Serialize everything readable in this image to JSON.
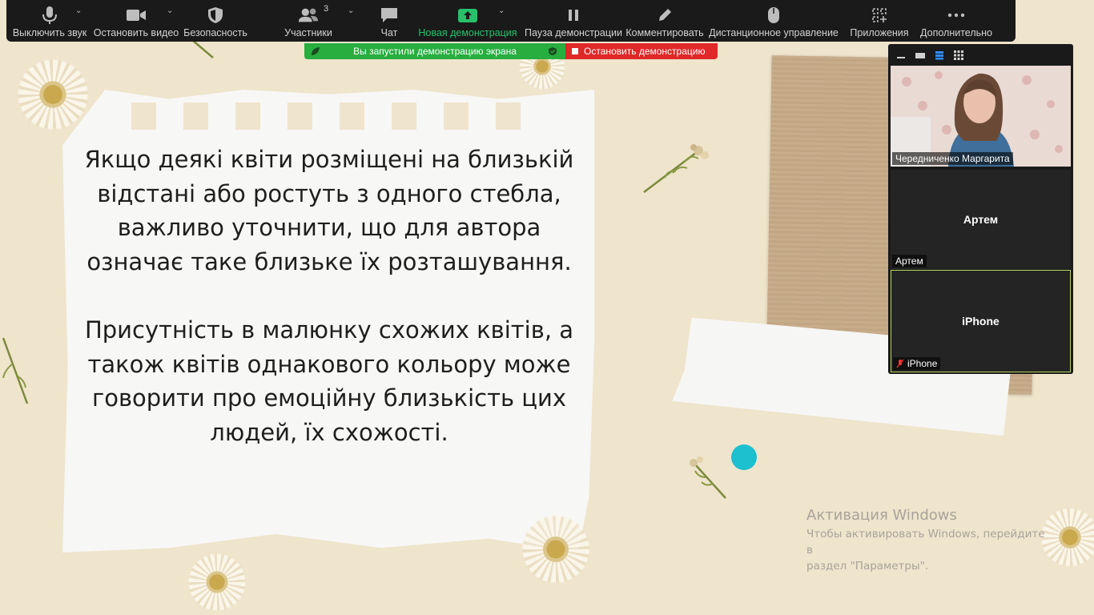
{
  "toolbar": {
    "items": [
      {
        "label": "Выключить звук",
        "icon": "microphone-icon"
      },
      {
        "label": "Остановить видео",
        "icon": "video-camera-icon"
      },
      {
        "label": "Безопасность",
        "icon": "shield-icon"
      },
      {
        "label": "Участники",
        "icon": "participants-icon",
        "badge": "3"
      },
      {
        "label": "Чат",
        "icon": "chat-bubble-icon"
      },
      {
        "label": "Новая демонстрация",
        "icon": "share-screen-icon"
      },
      {
        "label": "Пауза демонстрации",
        "icon": "pause-icon"
      },
      {
        "label": "Комментировать",
        "icon": "pencil-icon"
      },
      {
        "label": "Дистанционное управление",
        "icon": "mouse-icon"
      },
      {
        "label": "Приложения",
        "icon": "apps-icon"
      },
      {
        "label": "Дополнительно",
        "icon": "more-dots-icon"
      }
    ],
    "accent_color": "#25c26a"
  },
  "share_banner": {
    "status_text": "Вы запустили демонстрацию экрана",
    "stop_label": "Остановить демонстрацию",
    "status_color": "#27ae3f",
    "stop_color": "#e02828"
  },
  "slide": {
    "paragraph1": "Якщо деякі квіти розміщені на близькій відстані або ростуть з одного стебла, важливо уточнити, що для автора означає таке близьке їх розташування.",
    "paragraph2": "Присутність в малюнку схожих квітів, а також квітів однакового кольору може говорити про емоційну близькість цих людей, їх схожості."
  },
  "video_panel": {
    "participants": [
      {
        "display": "",
        "label": "Чередниченко Маргарита",
        "muted": false
      },
      {
        "display": "Артем",
        "label": "Артем",
        "muted": false
      },
      {
        "display": "iPhone",
        "label": "iPhone",
        "muted": true
      }
    ],
    "active_speaker_color": "#b8d55c"
  },
  "watermark": {
    "title": "Активация Windows",
    "line1": "Чтобы активировать Windows, перейдите в",
    "line2": "раздел \"Параметры\"."
  }
}
